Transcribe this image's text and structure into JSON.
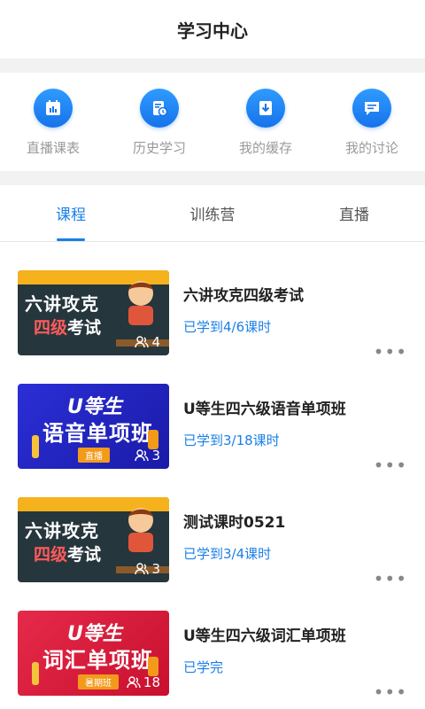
{
  "header": {
    "title": "学习中心"
  },
  "quick_actions": [
    {
      "label": "直播课表",
      "icon": "calendar-chart-icon"
    },
    {
      "label": "历史学习",
      "icon": "history-document-icon"
    },
    {
      "label": "我的缓存",
      "icon": "download-icon"
    },
    {
      "label": "我的讨论",
      "icon": "chat-bubble-icon"
    }
  ],
  "tabs": [
    {
      "label": "课程",
      "active": true
    },
    {
      "label": "训练营",
      "active": false
    },
    {
      "label": "直播",
      "active": false
    }
  ],
  "courses": [
    {
      "title": "六讲攻克四级考试",
      "progress": "已学到4/6课时",
      "thumb": {
        "line1": "六讲攻克",
        "line2_red": "四级",
        "line2_rest": "考试",
        "count": "4"
      }
    },
    {
      "title": "U等生四六级语音单项班",
      "progress": "已学到3/18课时",
      "thumb": {
        "brand": "U等生",
        "headline": "语音单项班",
        "tag": "直播",
        "count": "3"
      }
    },
    {
      "title": "测试课时0521",
      "progress": "已学到3/4课时",
      "thumb": {
        "line1": "六讲攻克",
        "line2_red": "四级",
        "line2_rest": "考试",
        "count": "3"
      }
    },
    {
      "title": "U等生四六级词汇单项班",
      "progress": "已学完",
      "thumb": {
        "brand": "U等生",
        "headline": "词汇单项班",
        "tag": "暑期班",
        "count": "18"
      }
    }
  ],
  "more_label": "•••",
  "colors": {
    "accent": "#1a7fe6",
    "icon_bg": "#1673ea"
  }
}
